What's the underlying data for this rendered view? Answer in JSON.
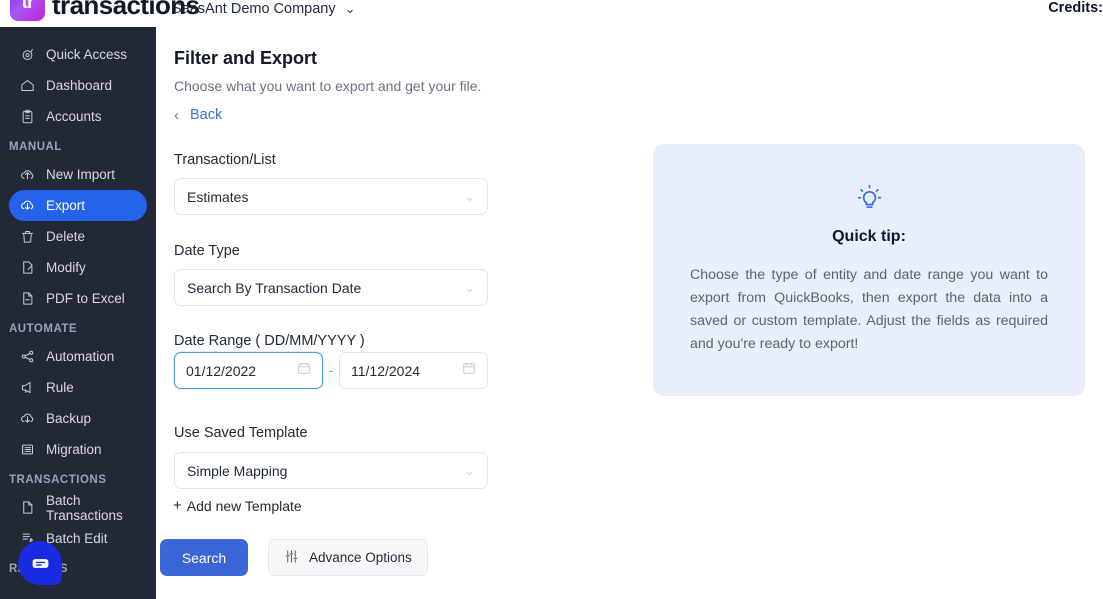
{
  "topbar": {
    "logo_glyph": "tr",
    "brand": "transactions",
    "company": "SaasAnt Demo Company",
    "company_chevron": "⌄",
    "credits": "Credits:"
  },
  "sidebar": {
    "groups": [
      {
        "header": null,
        "items": [
          {
            "label": "Quick Access",
            "icon": "target-icon",
            "active": false
          },
          {
            "label": "Dashboard",
            "icon": "home-icon",
            "active": false
          },
          {
            "label": "Accounts",
            "icon": "clipboard-icon",
            "active": false
          }
        ]
      },
      {
        "header": "MANUAL",
        "items": [
          {
            "label": "New Import",
            "icon": "cloud-upload-icon",
            "active": false
          },
          {
            "label": "Export",
            "icon": "cloud-download-icon",
            "active": true
          },
          {
            "label": "Delete",
            "icon": "trash-icon",
            "active": false
          },
          {
            "label": "Modify",
            "icon": "file-edit-icon",
            "active": false
          },
          {
            "label": "PDF to Excel",
            "icon": "file-pdf-icon",
            "active": false
          }
        ]
      },
      {
        "header": "AUTOMATE",
        "items": [
          {
            "label": "Automation",
            "icon": "share-nodes-icon",
            "active": false
          },
          {
            "label": "Rule",
            "icon": "megaphone-icon",
            "active": false
          },
          {
            "label": "Backup",
            "icon": "cloud-download-icon",
            "active": false
          },
          {
            "label": "Migration",
            "icon": "list-icon",
            "active": false
          }
        ]
      },
      {
        "header": "TRANSACTIONS",
        "items": [
          {
            "label": "Batch Transactions",
            "icon": "file-icon",
            "active": false
          },
          {
            "label": "Batch Edit",
            "icon": "file-lines-icon",
            "active": false
          }
        ]
      },
      {
        "header": "REPORTS",
        "items": []
      }
    ]
  },
  "main": {
    "title": "Filter and Export",
    "subtitle": "Choose what you want to export and get your file.",
    "back": {
      "label": "Back",
      "chevron": "‹"
    },
    "fields": {
      "transaction_list": {
        "label": "Transaction/List",
        "value": "Estimates",
        "chevron": "⌄"
      },
      "date_type": {
        "label": "Date Type",
        "value": "Search By Transaction Date",
        "chevron": "⌄"
      },
      "date_range": {
        "label": "Date Range ( DD/MM/YYYY )",
        "from": "01/12/2022",
        "to": "11/12/2024",
        "separator": "-"
      },
      "saved_template": {
        "label": "Use Saved Template",
        "value": "Simple Mapping",
        "chevron": "⌄"
      }
    },
    "add_template": {
      "plus": "+",
      "label": "Add new Template"
    },
    "buttons": {
      "search": "Search",
      "advance_options": "Advance Options"
    }
  },
  "tip": {
    "title": "Quick tip:",
    "body": "Choose the type of entity and date range you want to export from QuickBooks, then export the data into a saved or custom template. Adjust the fields as required and you're ready to export!"
  },
  "colors": {
    "accent_blue": "#2563eb",
    "button_blue": "#3b66d8",
    "sidebar_bg": "#232836",
    "tip_bg": "#e8eefb",
    "link_blue": "#3b6fd4"
  }
}
